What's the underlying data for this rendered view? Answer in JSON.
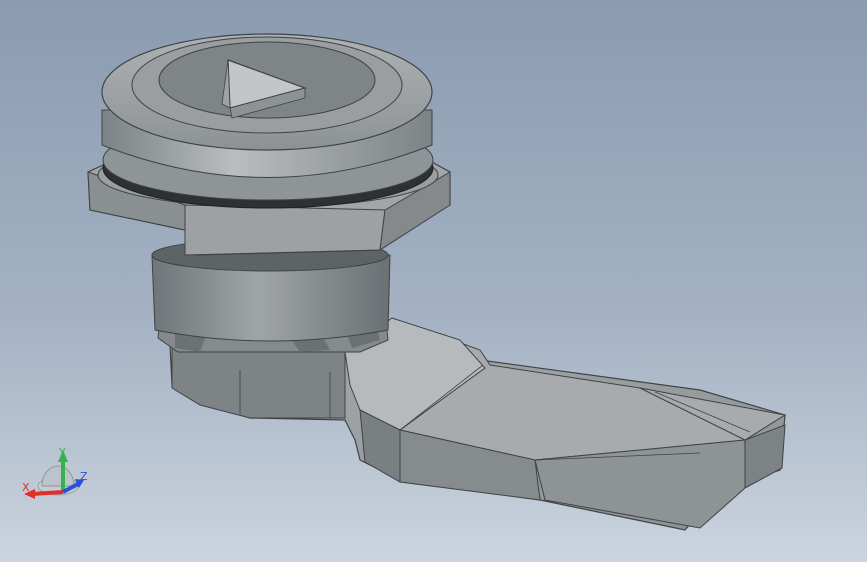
{
  "viewport": {
    "background_top": "#8b9bb0",
    "background_bottom": "#cbd4de",
    "model_color": "#8f9497"
  },
  "triad": {
    "x_label": "X",
    "y_label": "Y",
    "z_label": "Z",
    "x_color": "#e0302a",
    "y_color": "#33b34a",
    "z_color": "#2c4fd8"
  }
}
